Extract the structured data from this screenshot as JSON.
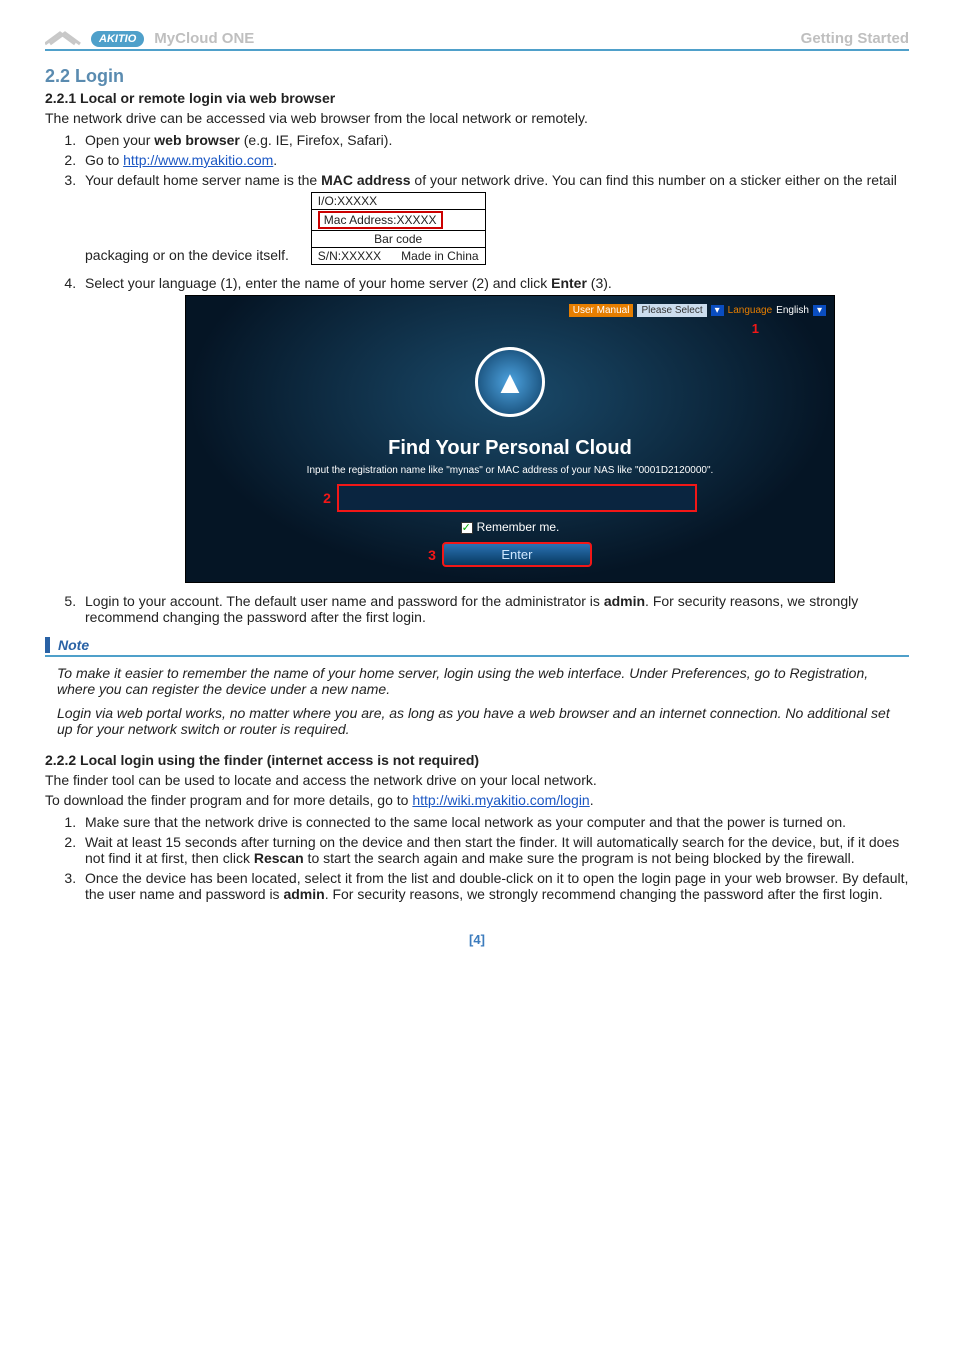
{
  "header": {
    "logo_text": "AKITIO",
    "product": "MyCloud ONE",
    "section": "Getting Started"
  },
  "s22": {
    "heading": "2.2  Login",
    "s1": {
      "heading": "2.2.1   Local or remote login via web browser",
      "intro": "The network drive can be accessed via web browser from the local network or remotely.",
      "li1_a": "Open your ",
      "li1_b": "web browser",
      "li1_c": " (e.g. IE, Firefox, Safari).",
      "li2_a": "Go to ",
      "li2_link": "http://www.myakitio.com",
      "li2_b": ".",
      "li3_a": "Your default home server name is the ",
      "li3_b": "MAC address",
      "li3_c": " of your network drive. You can find this number on a sticker either on the retail packaging or on the device itself.",
      "label": {
        "io": "I/O:XXXXX",
        "mac": "Mac Address:XXXXX",
        "bar": "Bar code",
        "sn": "S/N:XXXXX",
        "made": "Made in China"
      },
      "li4_a": "Select your language (1), enter the name of your home server (2) and click ",
      "li4_b": "Enter",
      "li4_c": " (3).",
      "shot": {
        "user_manual": "User Manual",
        "please_select": "Please Select",
        "language_label": "Language",
        "language_value": "English",
        "marker1": "1",
        "title": "Find Your Personal Cloud",
        "sub": "Input the registration name like \"mynas\" or MAC address of your NAS like \"0001D2120000\".",
        "marker2": "2",
        "remember": "Remember me.",
        "marker3": "3",
        "enter": "Enter"
      },
      "li5_a": "Login to your account. The default user name and password for the administrator is ",
      "li5_b": "admin",
      "li5_c": ". For security reasons, we strongly recommend changing the password after the first login."
    },
    "note": {
      "title": "Note",
      "p1": "To make it easier to remember the name of your home server, login using the web interface. Under Preferences, go to Registration, where you can register the device under a new name.",
      "p2": "Login via web portal works, no matter where you are, as long as you have a web browser and an internet connection. No additional set up for your network switch or router is required."
    },
    "s2": {
      "heading": "2.2.2   Local login using the finder (internet access is not required)",
      "intro_a": "The finder tool can be used to locate and access the network drive on your local network.",
      "intro_b": "To download the finder program and for more details, go to ",
      "intro_link": "http://wiki.myakitio.com/login",
      "intro_c": ".",
      "li1": "Make sure that the network drive is connected to the same local network as your computer and that the power is turned on.",
      "li2_a": "Wait at least 15 seconds after turning on the device and then start the finder. It will automatically search for the device, but, if it does not find it at first, then click ",
      "li2_b": "Rescan",
      "li2_c": " to start the search again and make sure the program is not being blocked by the firewall.",
      "li3_a": "Once the device has been located, select it from the list and double-click on it to open the login page in your web browser. By default, the user name and password is ",
      "li3_b": "admin",
      "li3_c": ". For security reasons, we strongly recommend changing the password after the first login."
    }
  },
  "page": "[4]"
}
